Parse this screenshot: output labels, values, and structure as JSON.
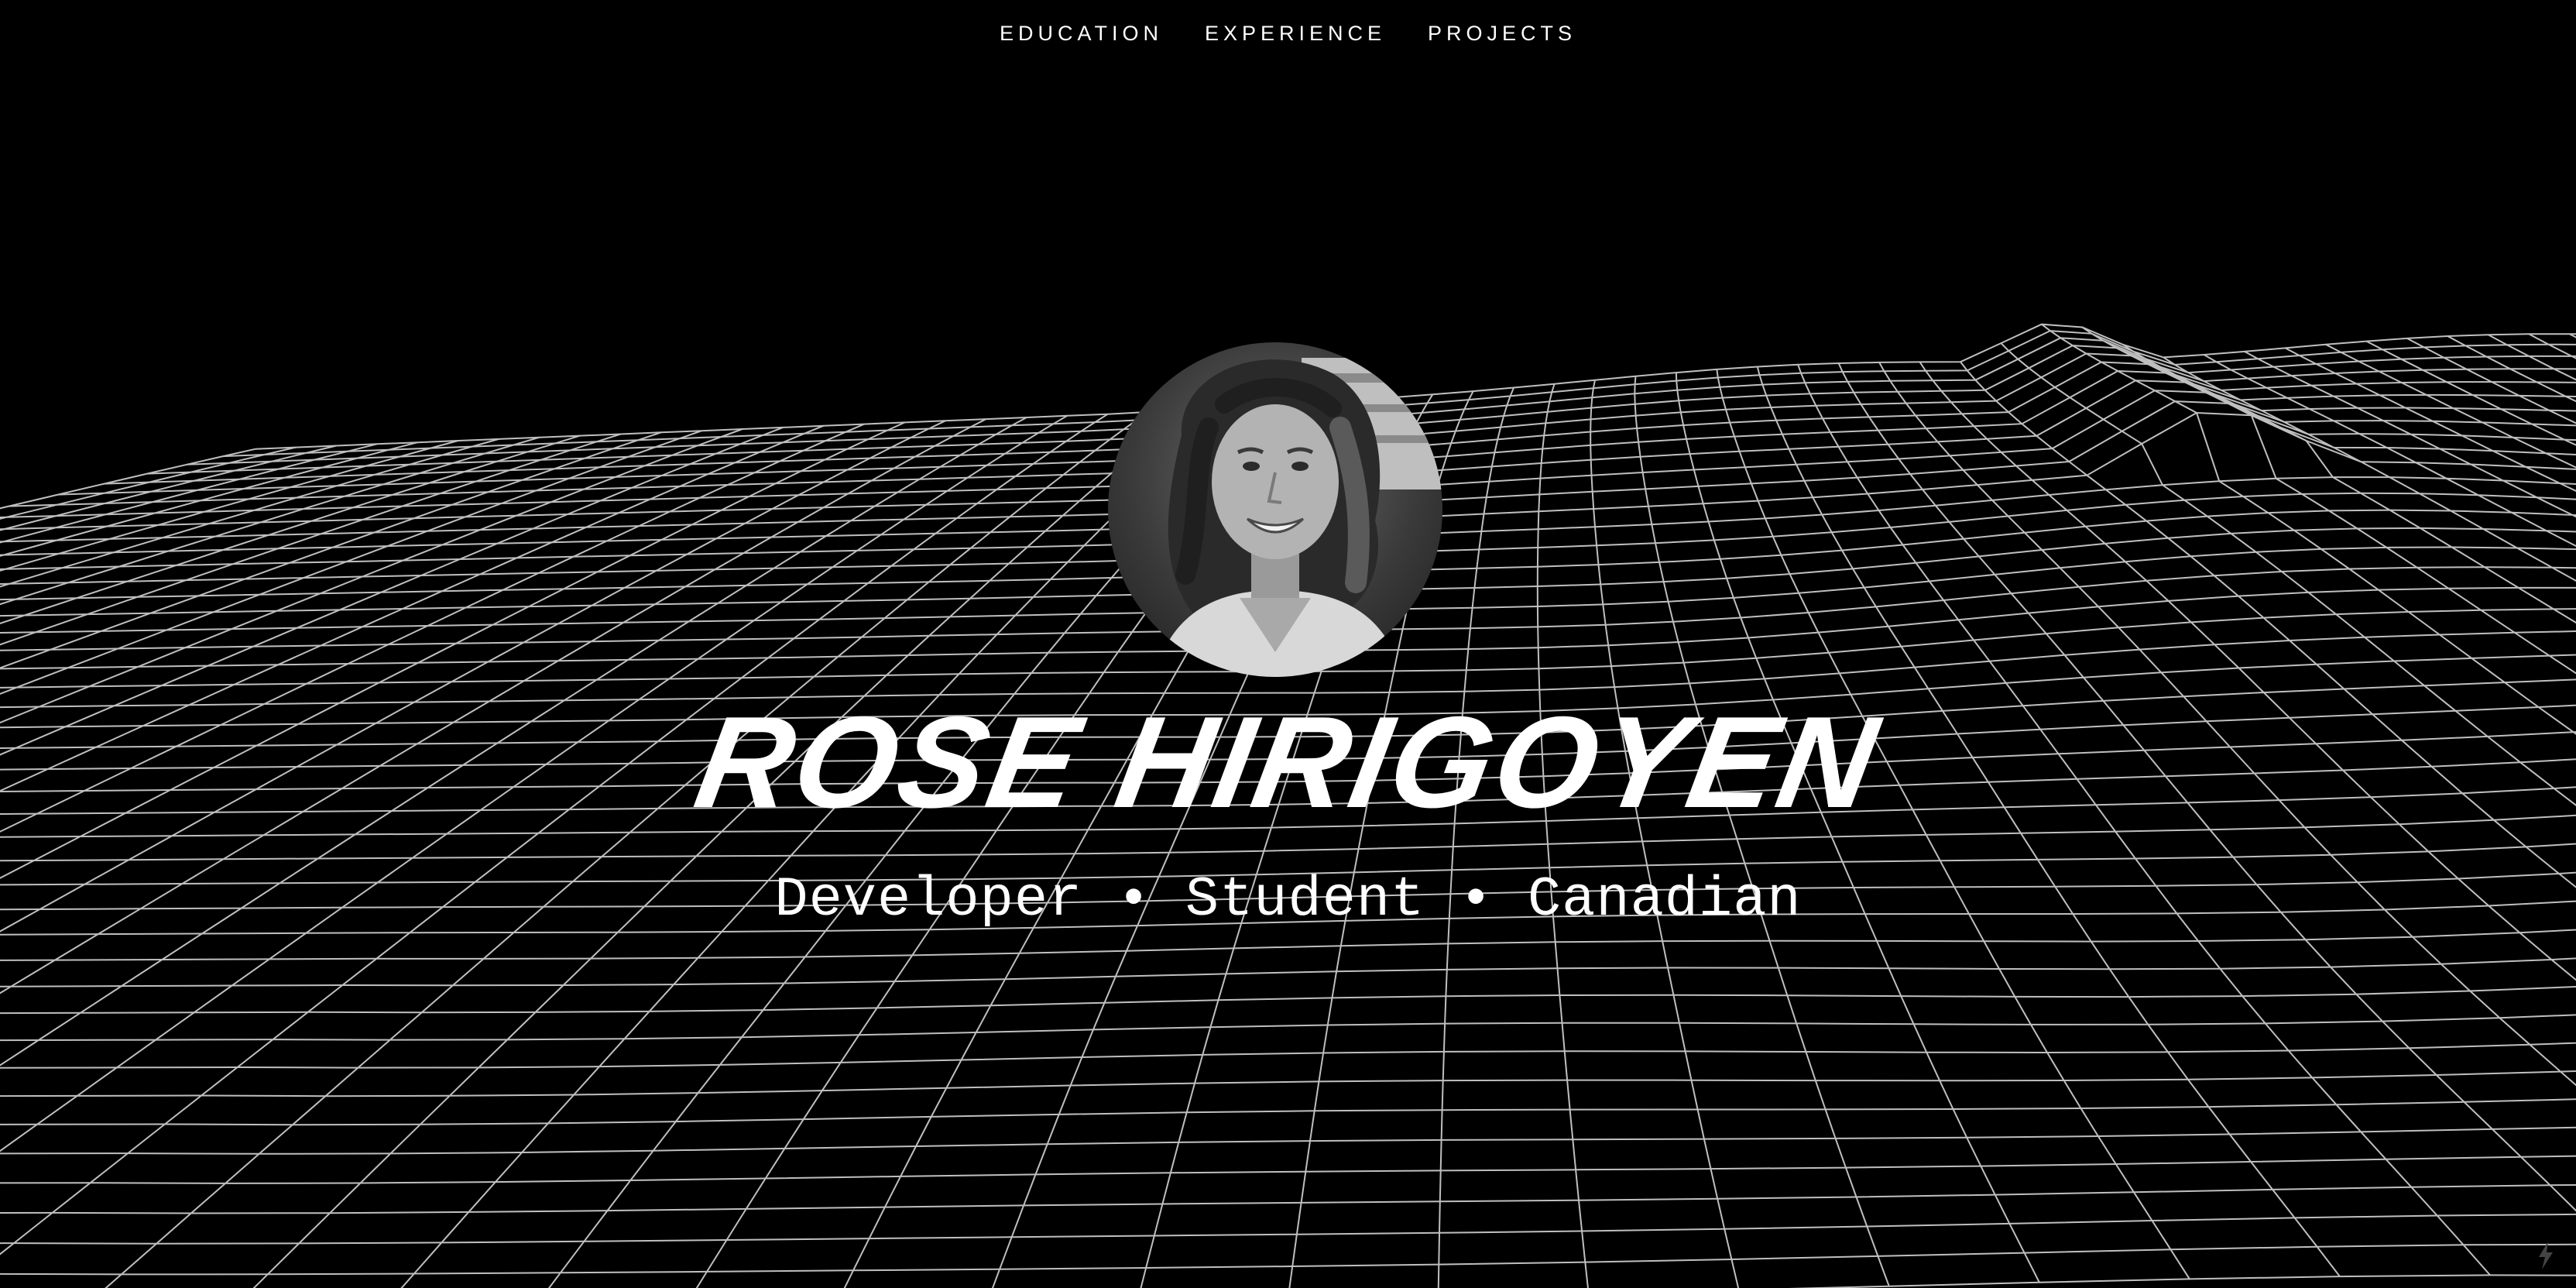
{
  "nav": {
    "items": [
      {
        "label": "EDUCATION"
      },
      {
        "label": "EXPERIENCE"
      },
      {
        "label": "PROJECTS"
      }
    ]
  },
  "hero": {
    "name": "ROSE HIRIGOYEN",
    "tagline": "Developer • Student • Canadian"
  },
  "colors": {
    "background": "#000000",
    "foreground": "#ffffff",
    "wireframe": "#ffffff"
  },
  "icons": {
    "corner": "lightning-icon"
  }
}
